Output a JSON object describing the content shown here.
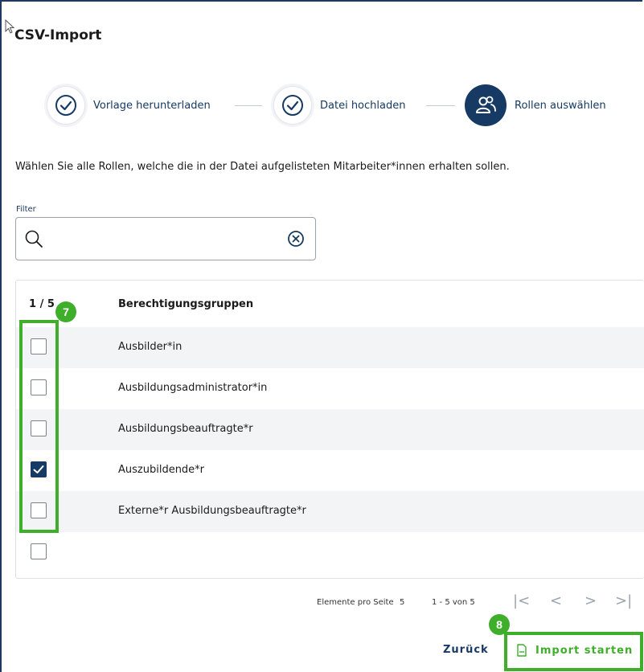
{
  "dialog": {
    "title": "CSV-Import"
  },
  "stepper": {
    "steps": [
      {
        "label": "Vorlage herunterladen",
        "state": "done",
        "icon": "check-circle-icon"
      },
      {
        "label": "Datei hochladen",
        "state": "done",
        "icon": "check-circle-icon"
      },
      {
        "label": "Rollen auswählen",
        "state": "active",
        "icon": "users-icon"
      }
    ]
  },
  "intro": "Wählen Sie alle Rollen, welche die in der Datei aufgelisteten Mitarbeiter*innen erhalten sollen.",
  "filter": {
    "label": "Filter",
    "value": "",
    "placeholder": ""
  },
  "table": {
    "count_header": "1 / 5",
    "title_header": "Berechtigungsgruppen",
    "rows": [
      {
        "label": "Ausbilder*in",
        "checked": false
      },
      {
        "label": "Ausbildungsadministrator*in",
        "checked": false
      },
      {
        "label": "Ausbildungsbeauftragte*r",
        "checked": false
      },
      {
        "label": "Auszubildende*r",
        "checked": true
      },
      {
        "label": "Externe*r Ausbildungsbeauftragte*r",
        "checked": false
      },
      {
        "label": "",
        "checked": false
      }
    ]
  },
  "pagination": {
    "per_page_label": "Elemente pro Seite",
    "per_page_value": "5",
    "range": "1 - 5 von 5",
    "first": "|<",
    "prev": "<",
    "next": ">",
    "last": ">|"
  },
  "actions": {
    "back_label": "Zurück",
    "import_label": "Import starten"
  },
  "annotations": {
    "badge_7": "7",
    "badge_8": "8"
  },
  "colors": {
    "primary": "#163a63",
    "annotation_green": "#3fae2a",
    "row_alt": "#f2f4f6"
  }
}
